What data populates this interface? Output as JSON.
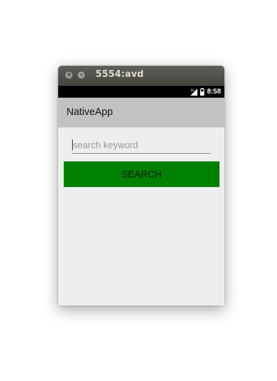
{
  "window": {
    "title": "5554:avd",
    "close_glyph": "×",
    "minimize_glyph": "–"
  },
  "status_bar": {
    "network_label": "3G",
    "time": "8:58",
    "icons": [
      "signal-3g-icon",
      "battery-icon"
    ]
  },
  "action_bar": {
    "title": "NativeApp"
  },
  "search": {
    "value": "",
    "placeholder": "search keyword",
    "button_label": "SEARCH"
  },
  "colors": {
    "button_bg": "#008000",
    "action_bar_bg": "#c2c2c2",
    "content_bg": "#eeeeee",
    "status_bar_bg": "#000000",
    "titlebar_bg": "#4f4e49"
  }
}
